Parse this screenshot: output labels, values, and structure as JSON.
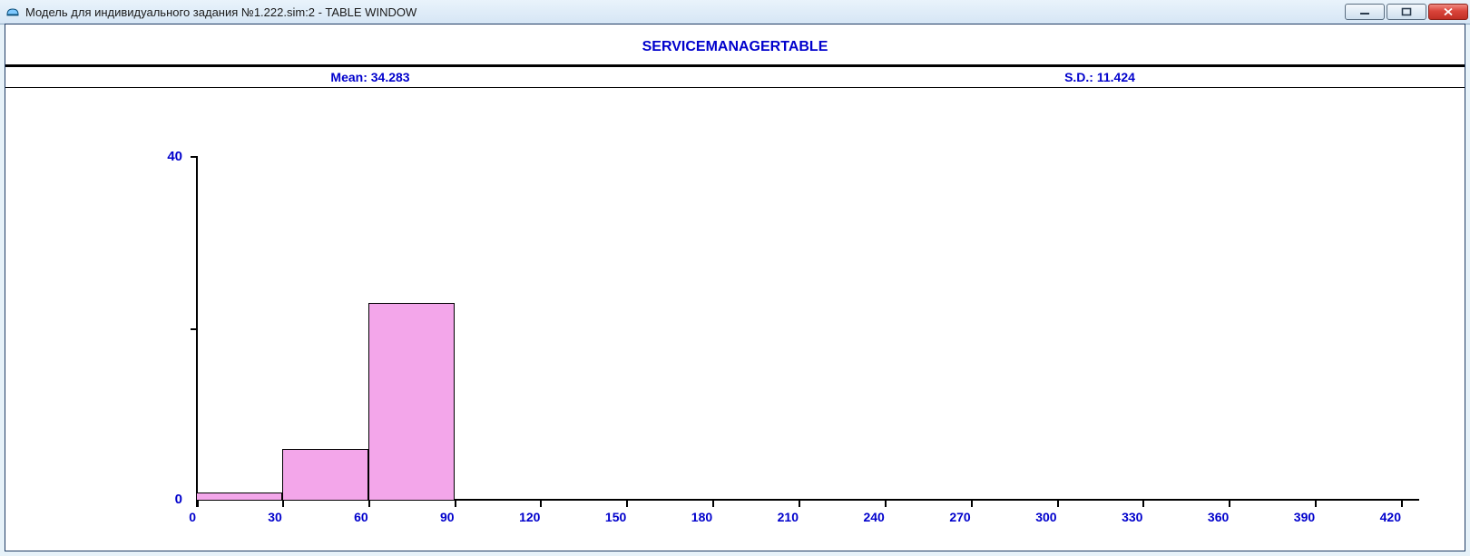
{
  "window": {
    "title": "Модель для индивидуального задания №1.222.sim:2  -  TABLE WINDOW"
  },
  "chart": {
    "title": "SERVICEMANAGERTABLE",
    "mean_label": "Mean: 34.283",
    "sd_label": "S.D.: 11.424"
  },
  "chart_data": {
    "type": "bar",
    "title": "SERVICEMANAGERTABLE",
    "xlabel": "",
    "ylabel": "",
    "ylim": [
      0,
      40
    ],
    "x_ticks": [
      0,
      30,
      60,
      90,
      120,
      150,
      180,
      210,
      240,
      270,
      300,
      330,
      360,
      390,
      420
    ],
    "categories": [
      "0–30",
      "30–60",
      "60–90"
    ],
    "bin_edges": [
      0,
      30,
      60,
      90
    ],
    "values": [
      1,
      6,
      23
    ],
    "mean": 34.283,
    "sd": 11.424,
    "bar_color": "#f3a6ea"
  }
}
